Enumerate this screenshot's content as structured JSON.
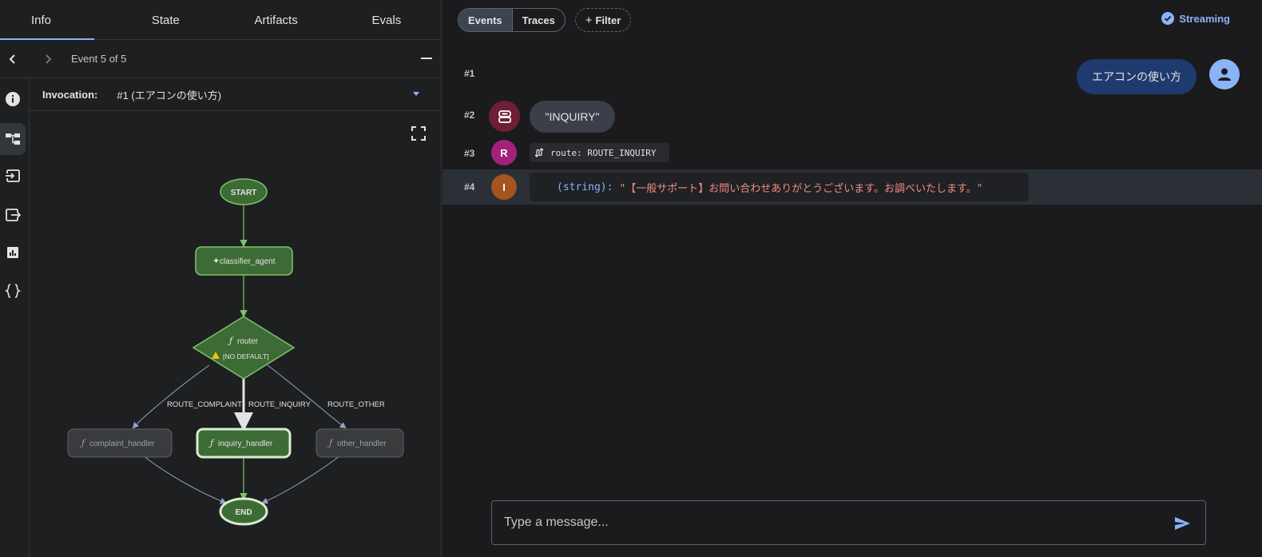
{
  "tabs": [
    {
      "label": "Info"
    },
    {
      "label": "State"
    },
    {
      "label": "Artifacts"
    },
    {
      "label": "Evals"
    }
  ],
  "event_nav": {
    "label": "Event 5 of 5"
  },
  "invocation": {
    "label": "Invocation:",
    "value": "#1 (エアコンの使い方)"
  },
  "siderail_icons": [
    "info-icon",
    "graph-icon",
    "input-icon",
    "output-icon",
    "chart-icon",
    "code-braces-icon"
  ],
  "graph": {
    "nodes": {
      "start": "START",
      "classifier": "classifier_agent",
      "router": "router",
      "router_warning": "[NO DEFAULT]",
      "complaint": "complaint_handler",
      "inquiry": "inquiry_handler",
      "other": "other_handler",
      "end": "END"
    },
    "edges": {
      "complaint": "ROUTE_COMPLAINT",
      "inquiry": "ROUTE_INQUIRY",
      "other": "ROUTE_OTHER"
    },
    "colors": {
      "active_fill": "#3d6b35",
      "active_stroke": "#7fc36b",
      "inactive_fill": "#3a3b3d",
      "edge": "#9aa0c8"
    }
  },
  "toolbar": {
    "events": "Events",
    "traces": "Traces",
    "filter": "Filter",
    "streaming": "Streaming"
  },
  "events": [
    {
      "num": "#1",
      "user_text": "エアコンの使い方"
    },
    {
      "num": "#2",
      "text": "\"INQUIRY\""
    },
    {
      "num": "#3",
      "avatar": "R",
      "route": "route: ROUTE_INQUIRY"
    },
    {
      "num": "#4",
      "avatar": "I",
      "type": "(string):",
      "value": "\"【一般サポート】お問い合わせありがとうございます。お調べいたします。\""
    }
  ],
  "composer": {
    "placeholder": "Type a message..."
  }
}
